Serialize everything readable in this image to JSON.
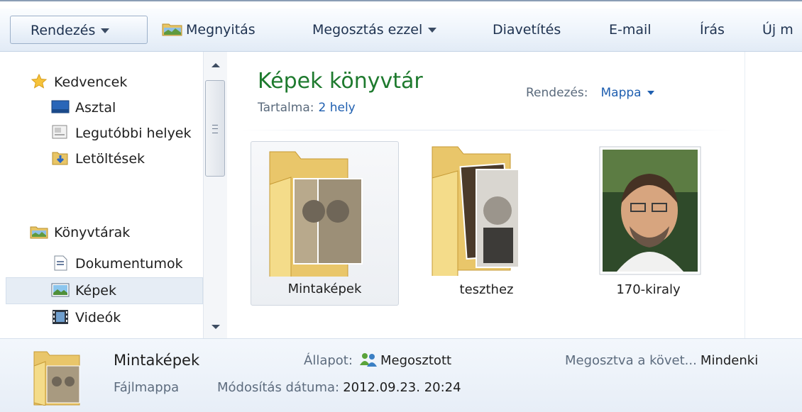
{
  "toolbar": {
    "organize": "Rendezés",
    "open": "Megnyitás",
    "share_with": "Megosztás ezzel",
    "slideshow": "Diavetítés",
    "email": "E-mail",
    "burn": "Írás",
    "new_folder": "Új m"
  },
  "nav": {
    "favorites": "Kedvencek",
    "desktop": "Asztal",
    "recent": "Legutóbbi helyek",
    "downloads": "Letöltések",
    "libraries": "Könyvtárak",
    "documents": "Dokumentumok",
    "pictures": "Képek",
    "videos": "Videók"
  },
  "library": {
    "title": "Képek könyvtár",
    "includes_label": "Tartalma:",
    "includes_value": "2 hely",
    "arrange_label": "Rendezés:",
    "arrange_value": "Mappa"
  },
  "items": [
    {
      "name": "Mintaképek",
      "kind": "folder",
      "selected": true
    },
    {
      "name": "teszthez",
      "kind": "folder",
      "selected": false
    },
    {
      "name": "170-kiraly",
      "kind": "image",
      "selected": false
    }
  ],
  "details": {
    "name": "Mintaképek",
    "type": "Fájlmappa",
    "state_label": "Állapot:",
    "state_value": "Megosztott",
    "modified_label": "Módosítás dátuma:",
    "modified_value": "2012.09.23. 20:24",
    "shared_with_label": "Megosztva a követ...",
    "shared_with_value": "Mindenki"
  },
  "colors": {
    "library_title": "#1e7a2e",
    "link": "#1f5fb0",
    "selection": "#e6edf5"
  }
}
